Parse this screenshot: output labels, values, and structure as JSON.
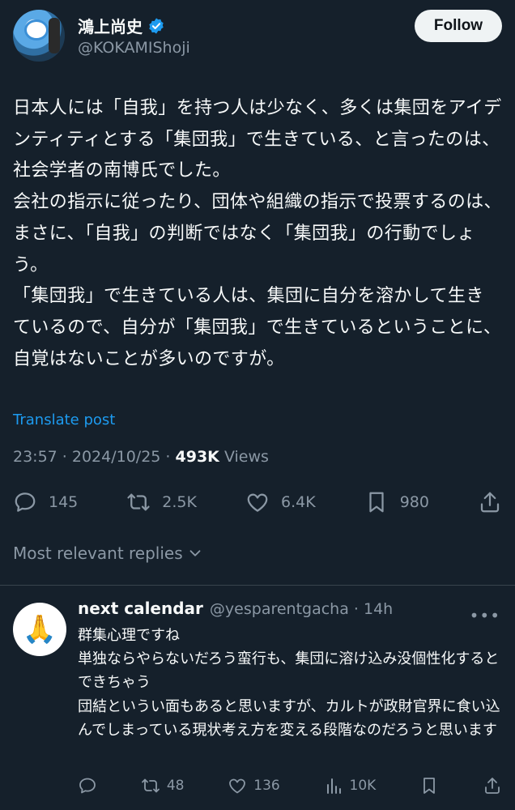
{
  "author": {
    "name": "鴻上尚史",
    "handle": "@KOKAMIShoji",
    "follow_label": "Follow"
  },
  "post": {
    "text": "日本人には「自我」を持つ人は少なく、多くは集団をアイデンティティとする「集団我」で生きている、と言ったのは、社会学者の南博氏でした。\n会社の指示に従ったり、団体や組織の指示で投票するのは、まさに、「自我」の判断ではなく「集団我」の行動でしょう。\n「集団我」で生きている人は、集団に自分を溶かして生きているので、自分が「集団我」で生きているということに、自覚はないことが多いのですが。",
    "translate_label": "Translate post",
    "time": "23:57 · 2024/10/25 · ",
    "views_count": "493K",
    "views_label": " Views",
    "replies": "145",
    "reposts": "2.5K",
    "likes": "6.4K",
    "bookmarks": "980"
  },
  "replies_sort_label": "Most relevant replies",
  "reply": {
    "avatar_emoji": "🙏",
    "name": "next calendar",
    "handle": "@yesparentgacha · 14h",
    "more": "•••",
    "text": "群集心理ですね\n単独ならやらないだろう蛮行も、集団に溶け込み没個性化するとできちゃう\n団結というい面もあると思いますが、カルトが政財官界に食い込んでしまっている現状考え方を変える段階なのだろうと思います",
    "reposts": "48",
    "likes": "136",
    "views": "10K"
  },
  "colors": {
    "background": "#15202b",
    "accent": "#1d9bf0",
    "muted": "#8b98a5",
    "text": "#f7f9f9"
  }
}
